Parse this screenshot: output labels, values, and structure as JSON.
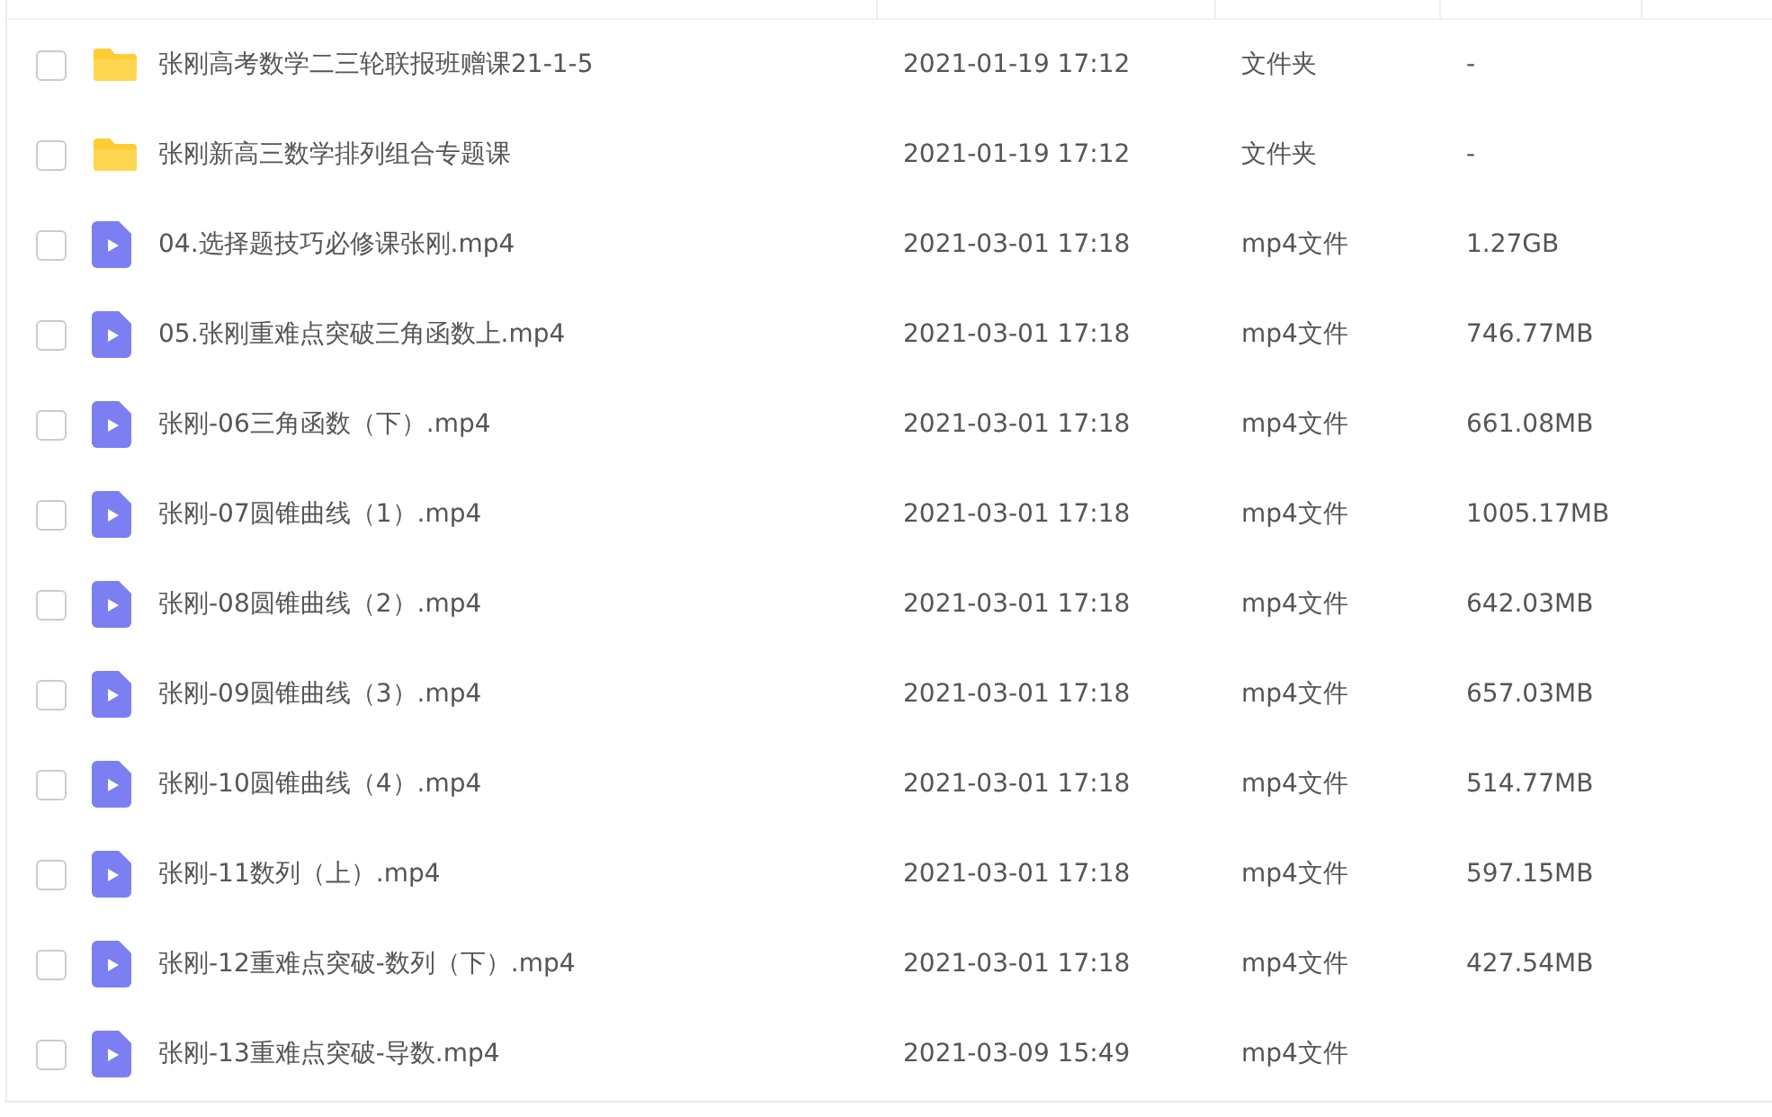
{
  "files": [
    {
      "kind": "folder",
      "checked": false,
      "name": "张刚高考数学二三轮联报班赠课21-1-5",
      "modified": "2021-01-19 17:12",
      "type": "文件夹",
      "size": "-"
    },
    {
      "kind": "folder",
      "checked": false,
      "name": "张刚新高三数学排列组合专题课",
      "modified": "2021-01-19 17:12",
      "type": "文件夹",
      "size": "-"
    },
    {
      "kind": "video",
      "checked": false,
      "name": "04.选择题技巧必修课张刚.mp4",
      "modified": "2021-03-01 17:18",
      "type": "mp4文件",
      "size": "1.27GB"
    },
    {
      "kind": "video",
      "checked": false,
      "name": "05.张刚重难点突破三角函数上.mp4",
      "modified": "2021-03-01 17:18",
      "type": "mp4文件",
      "size": "746.77MB"
    },
    {
      "kind": "video",
      "checked": false,
      "name": "张刚-06三角函数（下）.mp4",
      "modified": "2021-03-01 17:18",
      "type": "mp4文件",
      "size": "661.08MB"
    },
    {
      "kind": "video",
      "checked": false,
      "name": "张刚-07圆锥曲线（1）.mp4",
      "modified": "2021-03-01 17:18",
      "type": "mp4文件",
      "size": "1005.17MB"
    },
    {
      "kind": "video",
      "checked": false,
      "name": "张刚-08圆锥曲线（2）.mp4",
      "modified": "2021-03-01 17:18",
      "type": "mp4文件",
      "size": "642.03MB"
    },
    {
      "kind": "video",
      "checked": false,
      "name": "张刚-09圆锥曲线（3）.mp4",
      "modified": "2021-03-01 17:18",
      "type": "mp4文件",
      "size": "657.03MB"
    },
    {
      "kind": "video",
      "checked": false,
      "name": "张刚-10圆锥曲线（4）.mp4",
      "modified": "2021-03-01 17:18",
      "type": "mp4文件",
      "size": "514.77MB"
    },
    {
      "kind": "video",
      "checked": false,
      "name": "张刚-11数列（上）.mp4",
      "modified": "2021-03-01 17:18",
      "type": "mp4文件",
      "size": "597.15MB"
    },
    {
      "kind": "video",
      "checked": false,
      "name": "张刚-12重难点突破-数列（下）.mp4",
      "modified": "2021-03-01 17:18",
      "type": "mp4文件",
      "size": "427.54MB"
    },
    {
      "kind": "video",
      "checked": false,
      "name": "张刚-13重难点突破-导数.mp4",
      "modified": "2021-03-09 15:49",
      "type": "mp4文件"
    }
  ]
}
